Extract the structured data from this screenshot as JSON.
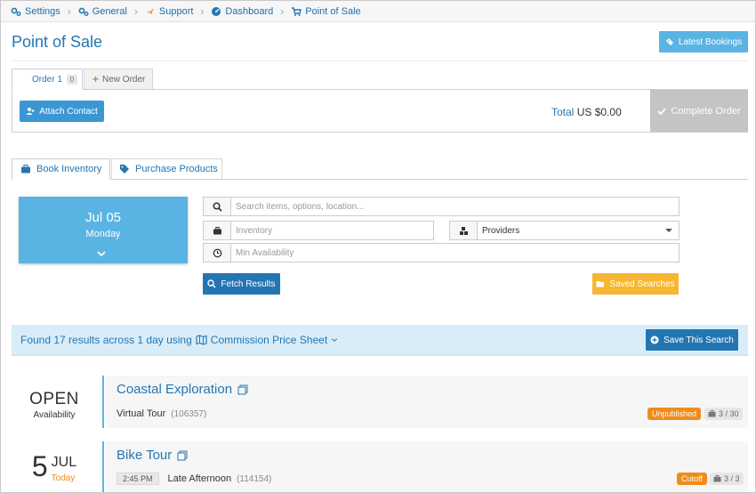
{
  "breadcrumb": {
    "items": [
      {
        "label": "Settings",
        "icon": "gears-icon"
      },
      {
        "label": "General",
        "icon": "gears-icon"
      },
      {
        "label": "Support",
        "icon": "rocket-icon"
      },
      {
        "label": "Dashboard",
        "icon": "dashboard-icon"
      },
      {
        "label": "Point of Sale",
        "icon": "cart-icon"
      }
    ]
  },
  "page": {
    "title": "Point of Sale",
    "latest_bookings_label": "Latest Bookings"
  },
  "order": {
    "tabs": [
      {
        "label": "Order 1",
        "count": "0"
      },
      {
        "label": "New Order"
      }
    ],
    "attach_contact_label": "Attach Contact",
    "total_label": "Total",
    "total_value": "US $0.00",
    "complete_label": "Complete Order"
  },
  "inventory_tabs": [
    {
      "label": "Book Inventory"
    },
    {
      "label": "Purchase Products"
    }
  ],
  "date_selector": {
    "date": "Jul 05",
    "weekday": "Monday"
  },
  "search": {
    "query_placeholder": "Search items, options, location...",
    "inventory_placeholder": "Inventory",
    "providers_value": "Providers",
    "availability_placeholder": "Min Availability",
    "fetch_label": "Fetch Results",
    "saved_label": "Saved Searches"
  },
  "results": {
    "summary": "Found 17 results across 1 day using",
    "price_sheet": "Commission Price Sheet",
    "save_search_label": "Save This Search",
    "items": [
      {
        "date_main": "OPEN",
        "date_sub": "Availability",
        "title": "Coastal Exploration",
        "option": "Virtual Tour",
        "code": "(106357)",
        "status": "Unpublished",
        "capacity": "3 / 30"
      },
      {
        "day": "5",
        "month": "JUL",
        "date_sub": "Today",
        "title": "Bike Tour",
        "time": "2:45 PM",
        "option": "Late Afternoon",
        "code": "(114154)",
        "status": "Cutoff",
        "capacity": "3 / 3"
      }
    ]
  },
  "colors": {
    "primary": "#2476b3",
    "accent": "#5ab4e3",
    "warning": "#f7b733",
    "status_orange": "#f08c1a"
  }
}
